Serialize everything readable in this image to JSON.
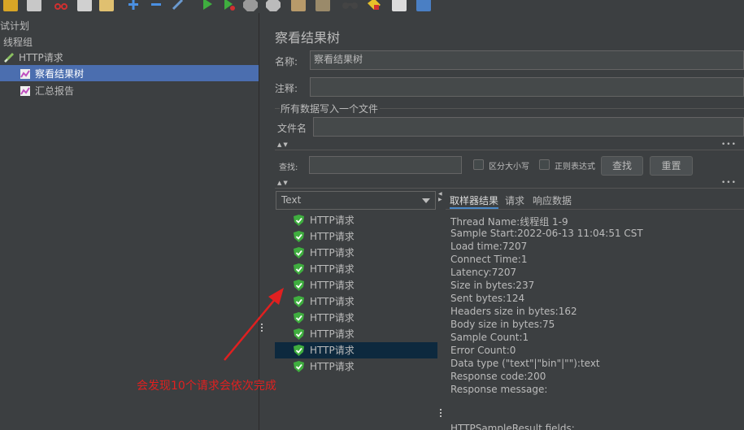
{
  "toolbar": {
    "icons": [
      "open-icon",
      "save-icon",
      "cut-icon",
      "copy-icon",
      "paste-icon",
      "add-icon",
      "remove-icon",
      "clear-icon",
      "start-icon",
      "start-no-pause-icon",
      "stop-icon",
      "shutdown-icon",
      "clear-all-icon",
      "broom-icon",
      "search-binoculars-icon",
      "reset-search-icon",
      "function-helper-icon",
      "help-icon"
    ]
  },
  "tree": {
    "items": [
      {
        "label": "试计划"
      },
      {
        "label": "线程组"
      },
      {
        "label": "HTTP请求"
      },
      {
        "label": "察看结果树"
      },
      {
        "label": "汇总报告"
      }
    ]
  },
  "panel": {
    "title": "察看结果树",
    "name_label": "名称:",
    "name_value": "察看结果树",
    "comment_label": "注释:",
    "comment_value": "",
    "file_group_label": "所有数据写入一个文件",
    "filename_label": "文件名",
    "filename_value": "",
    "search_label": "查找:",
    "search_value": "",
    "case_sensitive_label": "区分大小写",
    "regex_label": "正则表达式",
    "find_button": "查找",
    "reset_button": "重置",
    "renderer_selected": "Text"
  },
  "results": {
    "items": [
      {
        "label": "HTTP请求",
        "status": "success"
      },
      {
        "label": "HTTP请求",
        "status": "success"
      },
      {
        "label": "HTTP请求",
        "status": "success"
      },
      {
        "label": "HTTP请求",
        "status": "success"
      },
      {
        "label": "HTTP请求",
        "status": "success"
      },
      {
        "label": "HTTP请求",
        "status": "success"
      },
      {
        "label": "HTTP请求",
        "status": "success"
      },
      {
        "label": "HTTP请求",
        "status": "success"
      },
      {
        "label": "HTTP请求",
        "status": "success",
        "selected": true
      },
      {
        "label": "HTTP请求",
        "status": "success"
      }
    ]
  },
  "tabs": [
    {
      "label": "取样器结果",
      "active": true
    },
    {
      "label": "请求"
    },
    {
      "label": "响应数据"
    }
  ],
  "detail": {
    "lines": [
      "Thread Name:线程组 1-9",
      "Sample Start:2022-06-13 11:04:51 CST",
      "Load time:7207",
      "Connect Time:1",
      "Latency:7207",
      "Size in bytes:237",
      "Sent bytes:124",
      "Headers size in bytes:162",
      "Body size in bytes:75",
      "Sample Count:1",
      "Error Count:0",
      "Data type (\"text\"|\"bin\"|\"\"):text",
      "Response code:200",
      "Response message:",
      "",
      "",
      "HTTPSampleResult fields:"
    ]
  },
  "annotation": {
    "text": "会发现10个请求会依次完成",
    "color": "#e02020"
  },
  "colors": {
    "background": "#3c3f41",
    "selection": "#4b6eaf",
    "selected_result": "#0d293e",
    "success_green": "#3fae3f"
  }
}
